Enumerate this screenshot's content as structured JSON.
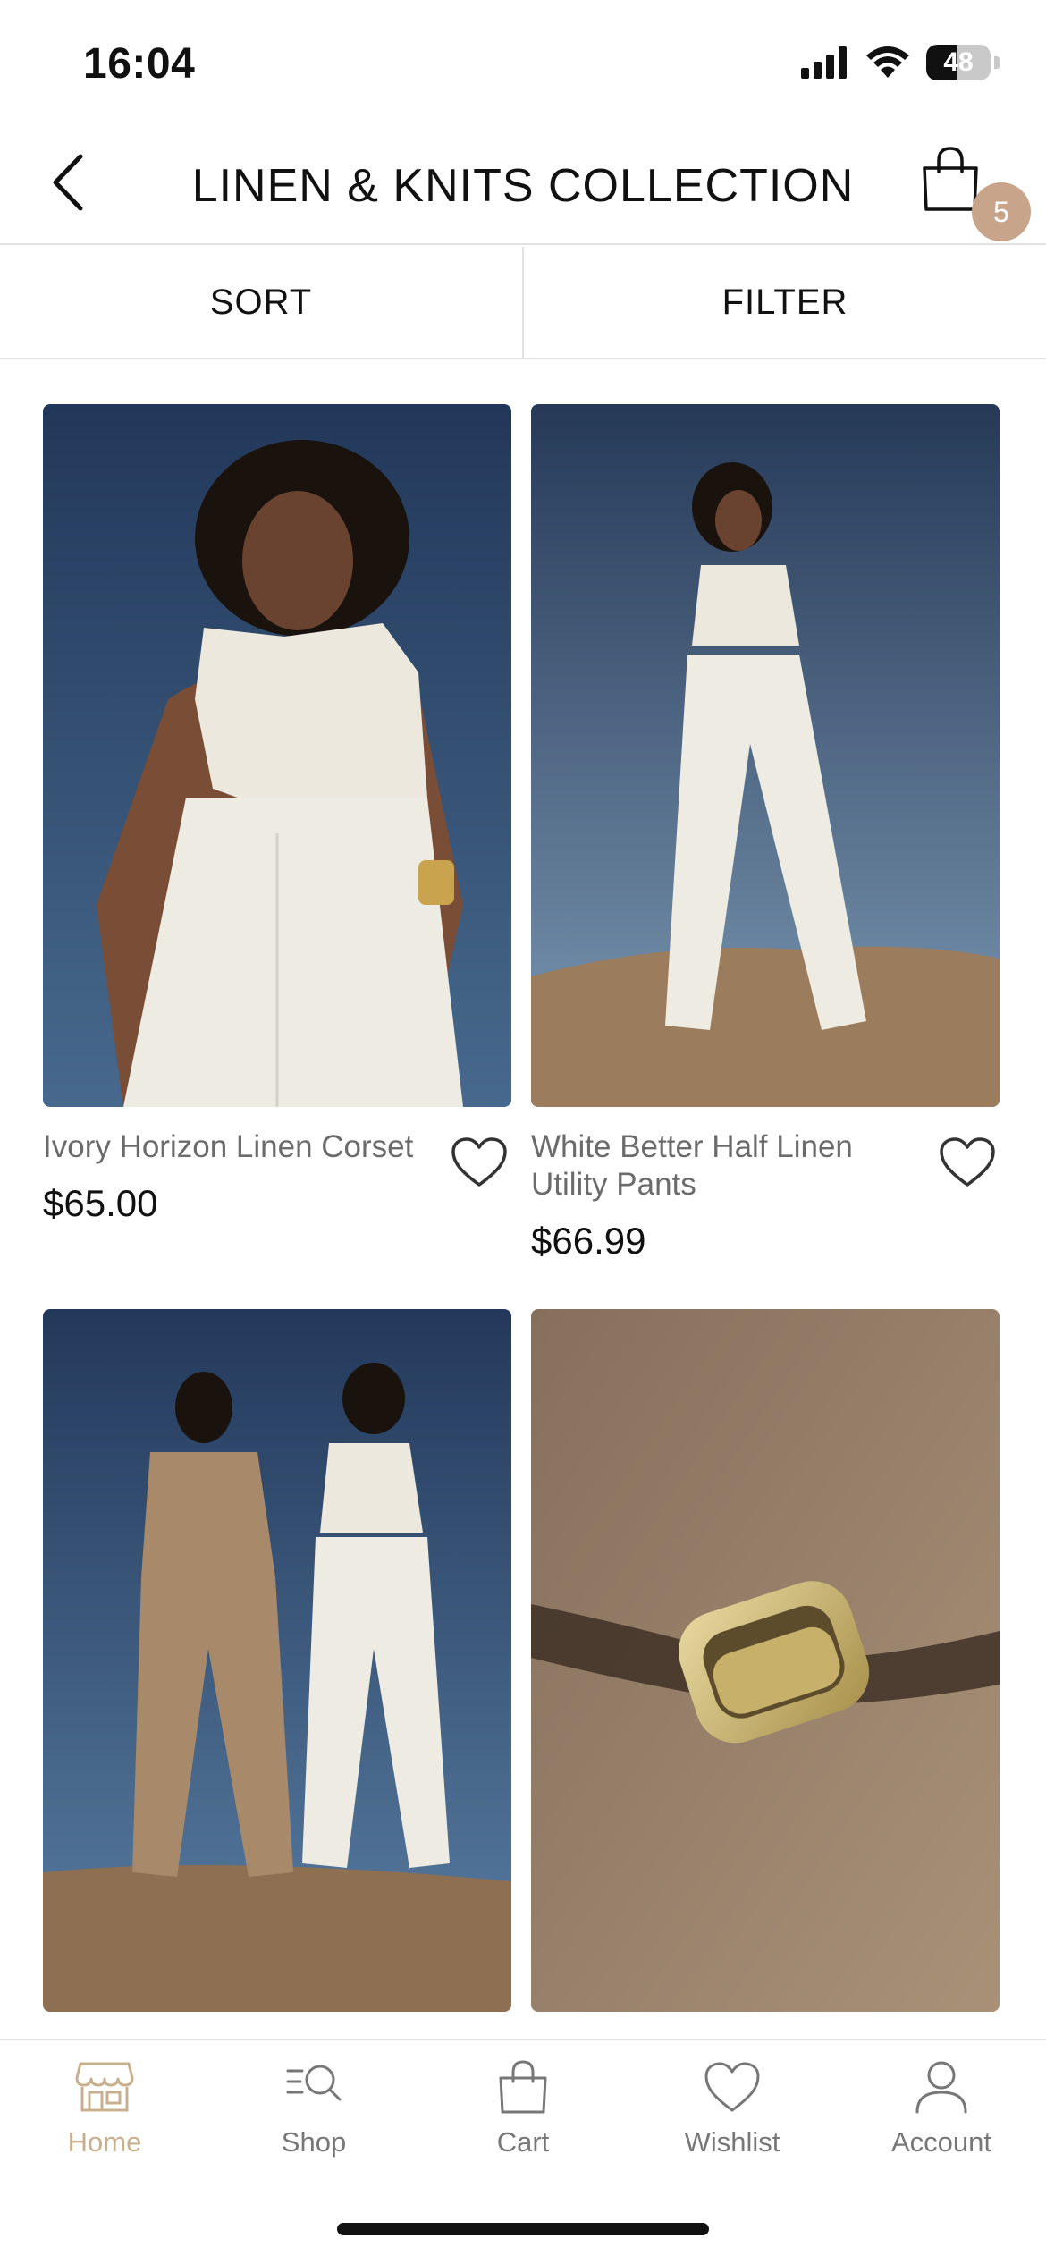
{
  "status_bar": {
    "time": "16:04",
    "battery_level": "48",
    "icons": [
      "cellular-signal-icon",
      "wifi-icon",
      "battery-icon"
    ]
  },
  "header": {
    "title": "LINEN & KNITS COLLECTION",
    "cart_count": "5",
    "icons": [
      "chevron-left-icon",
      "shopping-bag-icon"
    ]
  },
  "toolbar": {
    "sort_label": "SORT",
    "filter_label": "FILTER"
  },
  "products": [
    {
      "name": "Ivory Horizon Linen Corset",
      "price": "$65.00"
    },
    {
      "name": "White Better Half Linen Utility Pants",
      "price": "$66.99"
    },
    {
      "name": "",
      "price": ""
    },
    {
      "name": "",
      "price": ""
    }
  ],
  "tabbar": {
    "items": [
      {
        "label": "Home",
        "icon": "storefront-icon",
        "active": true
      },
      {
        "label": "Shop",
        "icon": "search-list-icon",
        "active": false
      },
      {
        "label": "Cart",
        "icon": "shopping-bag-icon",
        "active": false
      },
      {
        "label": "Wishlist",
        "icon": "heart-icon",
        "active": false
      },
      {
        "label": "Account",
        "icon": "user-icon",
        "active": false
      }
    ]
  },
  "colors": {
    "accent": "#c8a58a",
    "active_tab": "#c8b08f",
    "price_text": "#111111",
    "name_text": "#6b6b6b"
  }
}
